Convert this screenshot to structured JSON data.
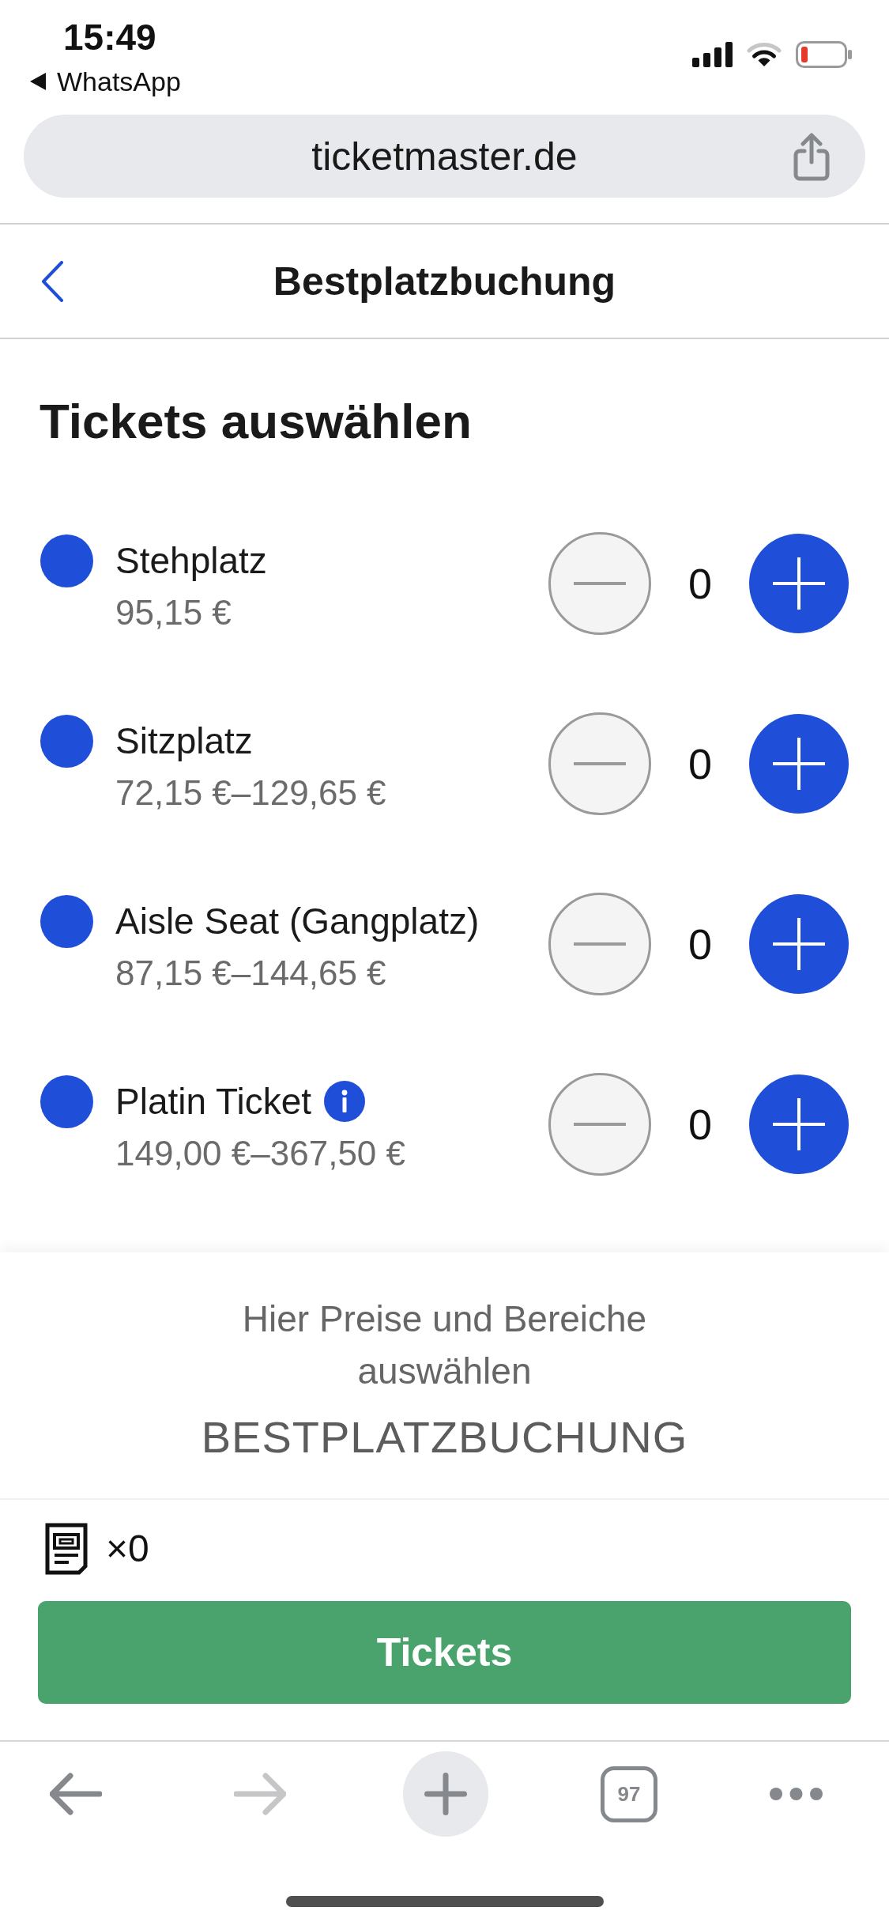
{
  "status_bar": {
    "time": "15:49",
    "back_app": "WhatsApp"
  },
  "browser": {
    "url": "ticketmaster.de"
  },
  "header": {
    "title": "Bestplatzbuchung"
  },
  "section_title": "Tickets auswählen",
  "tickets": [
    {
      "name": "Stehplatz",
      "price": "95,15 €",
      "quantity": "0",
      "color": "#1f4fd8",
      "info": false,
      "decrease_disabled": true
    },
    {
      "name": "Sitzplatz",
      "price": "72,15 €–129,65 €",
      "quantity": "0",
      "color": "#1f4fd8",
      "info": false,
      "decrease_disabled": true
    },
    {
      "name": "Aisle Seat (Gangplatz)",
      "price": "87,15 €–144,65 €",
      "quantity": "0",
      "color": "#1f4fd8",
      "info": false,
      "decrease_disabled": true
    },
    {
      "name": "Platin Ticket",
      "price": "149,00 €–367,50 €",
      "quantity": "0",
      "color": "#1f4fd8",
      "info": true,
      "decrease_disabled": true
    }
  ],
  "summary": {
    "hint": "Hier Preise und Bereiche auswählen",
    "title": "BESTPLATZBUCHUNG"
  },
  "cart": {
    "count": "×0",
    "button": "Tickets"
  },
  "toolbar": {
    "tab_count": "97",
    "forward_disabled": true
  }
}
